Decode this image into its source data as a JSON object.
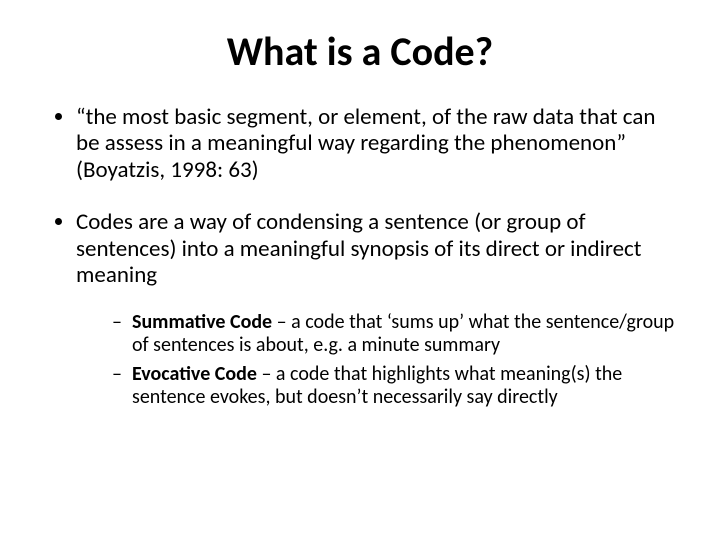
{
  "title": "What is a Code?",
  "bullets": [
    "“the most basic segment, or element, of the raw data that can be assess in a meaningful way regarding the phenomenon” (Boyatzis, 1998: 63)",
    "Codes are a way of condensing a sentence (or group of sentences) into a meaningful synopsis of its direct or indirect meaning"
  ],
  "sub": [
    {
      "label": "Summative Code",
      "text": " – a code that ‘sums up’ what the sentence/group of sentences is about, e.g. a minute summary"
    },
    {
      "label": "Evocative Code",
      "text": " – a code that highlights what meaning(s) the sentence evokes, but doesn’t necessarily say directly"
    }
  ]
}
